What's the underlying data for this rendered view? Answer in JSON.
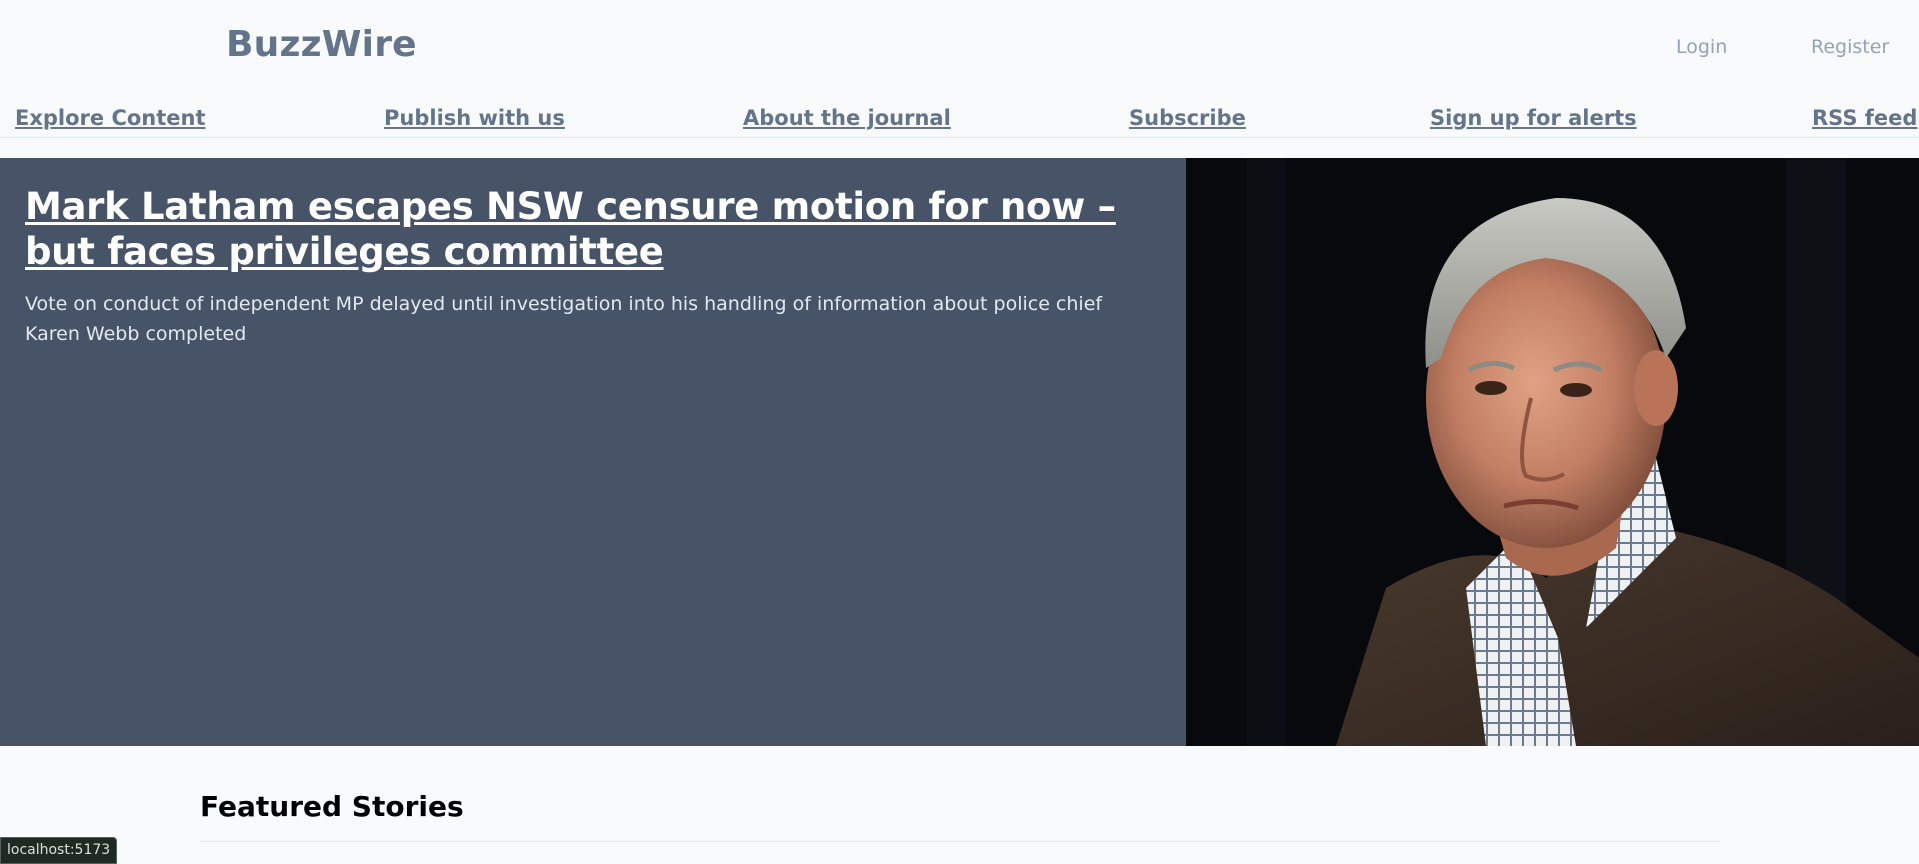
{
  "header": {
    "logo": "BuzzWire",
    "login_label": "Login",
    "register_label": "Register"
  },
  "nav": {
    "items": [
      {
        "label": "Explore Content"
      },
      {
        "label": "Publish with us"
      },
      {
        "label": "About the journal"
      },
      {
        "label": "Subscribe"
      },
      {
        "label": "Sign up for alerts"
      },
      {
        "label": "RSS feed"
      }
    ]
  },
  "hero": {
    "title": "Mark Latham escapes NSW censure motion for now – but faces privileges committee",
    "dek": "Vote on conduct of independent MP delayed until investigation into his handling of information about police chief Karen Webb completed",
    "image_alt": "Portrait photo of Mark Latham"
  },
  "featured": {
    "heading": "Featured Stories"
  },
  "status_bar": {
    "url": "localhost:5173"
  },
  "colors": {
    "page_bg": "#f8fafc",
    "hero_panel": "#475467",
    "link_muted": "#64748b",
    "auth_link": "#94a3b8"
  }
}
